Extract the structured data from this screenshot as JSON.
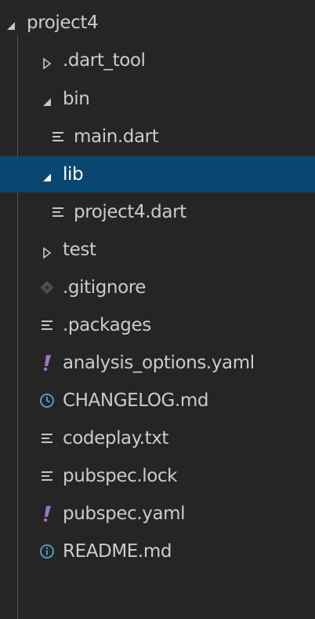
{
  "explorer": {
    "root": {
      "label": "project4",
      "expanded": true
    },
    "items": [
      {
        "label": ".dart_tool",
        "kind": "folder",
        "expanded": false
      },
      {
        "label": "bin",
        "kind": "folder",
        "expanded": true
      },
      {
        "label": "main.dart",
        "kind": "file",
        "icon": "lines-file-icon"
      },
      {
        "label": "lib",
        "kind": "folder",
        "expanded": true,
        "selected": true
      },
      {
        "label": "project4.dart",
        "kind": "file",
        "icon": "lines-file-icon"
      },
      {
        "label": "test",
        "kind": "folder",
        "expanded": false
      },
      {
        "label": ".gitignore",
        "kind": "file",
        "icon": "git-icon"
      },
      {
        "label": ".packages",
        "kind": "file",
        "icon": "lines-file-icon"
      },
      {
        "label": "analysis_options.yaml",
        "kind": "file",
        "icon": "yaml-exclamation-icon"
      },
      {
        "label": "CHANGELOG.md",
        "kind": "file",
        "icon": "clock-icon"
      },
      {
        "label": "codeplay.txt",
        "kind": "file",
        "icon": "lines-file-icon"
      },
      {
        "label": "pubspec.lock",
        "kind": "file",
        "icon": "lines-file-icon"
      },
      {
        "label": "pubspec.yaml",
        "kind": "file",
        "icon": "yaml-exclamation-icon"
      },
      {
        "label": "README.md",
        "kind": "file",
        "icon": "info-icon"
      }
    ]
  },
  "colors": {
    "background": "#252526",
    "selection": "#094771",
    "text": "#cccccc",
    "yaml_icon": "#a074c4",
    "info_icon": "#519aba",
    "git_icon": "#41535b"
  }
}
